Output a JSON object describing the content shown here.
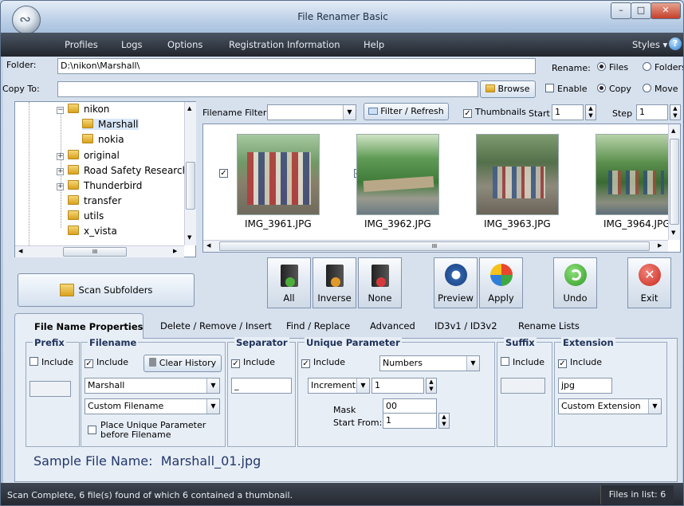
{
  "window": {
    "title": "File Renamer Basic"
  },
  "menu": {
    "items": [
      "Profiles",
      "Logs",
      "Options",
      "Registration Information",
      "Help"
    ],
    "styles": "Styles"
  },
  "folder": {
    "label": "Folder:",
    "value": "D:\\nikon\\Marshall\\"
  },
  "rename": {
    "label": "Rename:",
    "files": "Files",
    "folders": "Folders"
  },
  "copyto": {
    "label": "Copy To:",
    "value": "",
    "browse": "Browse",
    "enable": "Enable",
    "copy": "Copy",
    "move": "Move"
  },
  "tree": {
    "items": [
      {
        "label": "nikon"
      },
      {
        "label": "Marshall"
      },
      {
        "label": "nokia"
      },
      {
        "label": "original"
      },
      {
        "label": "Road Safety Research"
      },
      {
        "label": "Thunderbird"
      },
      {
        "label": "transfer"
      },
      {
        "label": "utils"
      },
      {
        "label": "x_vista"
      }
    ],
    "hscroll": "III"
  },
  "filter": {
    "label": "Filename Filter:",
    "value": "",
    "refresh": "Filter / Refresh",
    "thumbnails": "Thumbnails",
    "start_label": "Start",
    "start": "1",
    "step_label": "Step",
    "step": "1"
  },
  "thumbs": [
    {
      "name": "IMG_3961.JPG"
    },
    {
      "name": "IMG_3962.JPG"
    },
    {
      "name": "IMG_3963.JPG"
    },
    {
      "name": "IMG_3964.JPG"
    }
  ],
  "thumb_scroll": "III",
  "actions": {
    "scan": "Scan Subfolders",
    "all": "All",
    "inverse": "Inverse",
    "none": "None",
    "preview": "Preview",
    "apply": "Apply",
    "undo": "Undo",
    "exit": "Exit"
  },
  "tabs": [
    "File Name Properties",
    "Delete / Remove / Insert",
    "Find / Replace",
    "Advanced",
    "ID3v1 / ID3v2",
    "Rename Lists"
  ],
  "props": {
    "prefix": {
      "title": "Prefix",
      "include": "Include",
      "value": ""
    },
    "filename": {
      "title": "Filename",
      "include": "Include",
      "clear": "Clear History",
      "value": "Marshall",
      "mode": "Custom Filename",
      "place_unique": "Place Unique Parameter before Filename"
    },
    "separator": {
      "title": "Separator",
      "include": "Include",
      "value": "_"
    },
    "unique": {
      "title": "Unique Parameter",
      "include": "Include",
      "type": "Numbers",
      "inc_mode": "Increment",
      "inc_value": "1",
      "mask_label": "Mask",
      "mask": "00",
      "start_label": "Start From:",
      "start": "1"
    },
    "suffix": {
      "title": "Suffix",
      "include": "Include",
      "value": ""
    },
    "extension": {
      "title": "Extension",
      "include": "Include",
      "value": "jpg",
      "mode": "Custom Extension"
    }
  },
  "sample": {
    "label": "Sample File Name:",
    "value": "Marshall_01.jpg"
  },
  "status": {
    "text": "Scan Complete, 6 file(s) found of which 6 contained a thumbnail.",
    "files": "Files in list: 6"
  }
}
